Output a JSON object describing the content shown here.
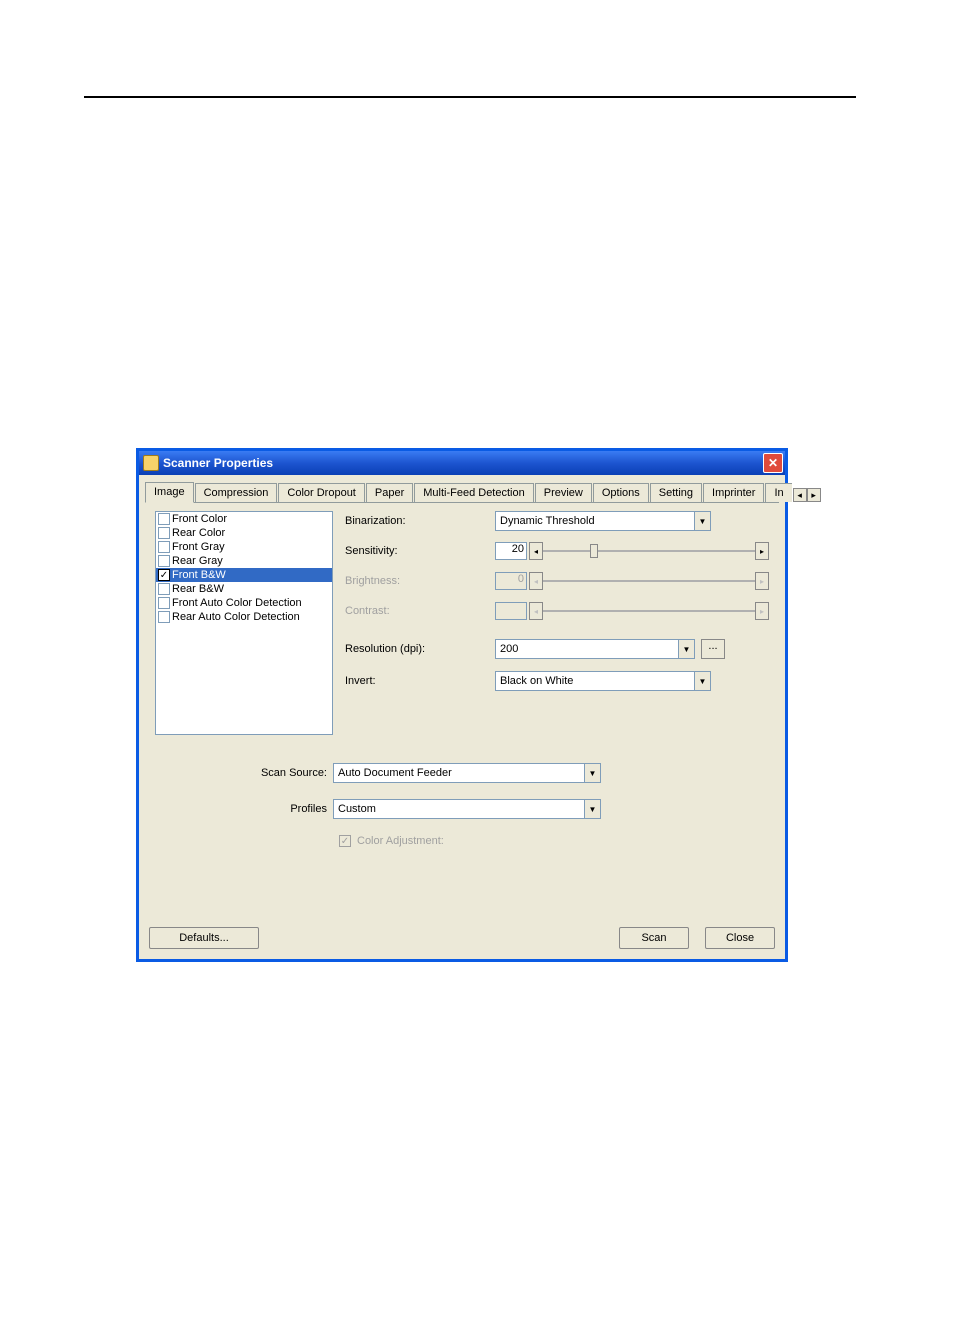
{
  "titlebar": {
    "title": "Scanner Properties",
    "close_glyph": "✕"
  },
  "tabs": {
    "items": [
      "Image",
      "Compression",
      "Color Dropout",
      "Paper",
      "Multi-Feed Detection",
      "Preview",
      "Options",
      "Setting",
      "Imprinter"
    ],
    "overflow_hint": "In",
    "scroll_left": "◂",
    "scroll_right": "▸",
    "active_index": 0
  },
  "image_list": {
    "items": [
      {
        "label": "Front Color",
        "checked": false,
        "selected": false
      },
      {
        "label": "Rear Color",
        "checked": false,
        "selected": false
      },
      {
        "label": "Front Gray",
        "checked": false,
        "selected": false
      },
      {
        "label": "Rear Gray",
        "checked": false,
        "selected": false
      },
      {
        "label": "Front B&W",
        "checked": true,
        "selected": true
      },
      {
        "label": "Rear B&W",
        "checked": false,
        "selected": false
      },
      {
        "label": "Front Auto Color Detection",
        "checked": false,
        "selected": false
      },
      {
        "label": "Rear Auto Color Detection",
        "checked": false,
        "selected": false
      }
    ]
  },
  "settings": {
    "binarization": {
      "label": "Binarization:",
      "value": "Dynamic Threshold"
    },
    "sensitivity": {
      "label": "Sensitivity:",
      "value": "20",
      "thumb_percent": 22
    },
    "brightness": {
      "label": "Brightness:",
      "value": "0",
      "disabled": true
    },
    "contrast": {
      "label": "Contrast:",
      "value": "",
      "disabled": true
    },
    "resolution": {
      "label": "Resolution (dpi):",
      "value": "200",
      "more": "..."
    },
    "invert": {
      "label": "Invert:",
      "value": "Black on White"
    }
  },
  "lower": {
    "scan_source": {
      "label": "Scan Source:",
      "value": "Auto Document Feeder"
    },
    "profiles": {
      "label": "Profiles",
      "value": "Custom"
    },
    "color_adjustment": {
      "label": "Color Adjustment:",
      "checked": true
    }
  },
  "footer": {
    "defaults": "Defaults...",
    "scan": "Scan",
    "close": "Close"
  },
  "slider_glyphs": {
    "left": "◂",
    "right": "▸"
  },
  "combo_arrow": "▼",
  "check_glyph": "✓"
}
